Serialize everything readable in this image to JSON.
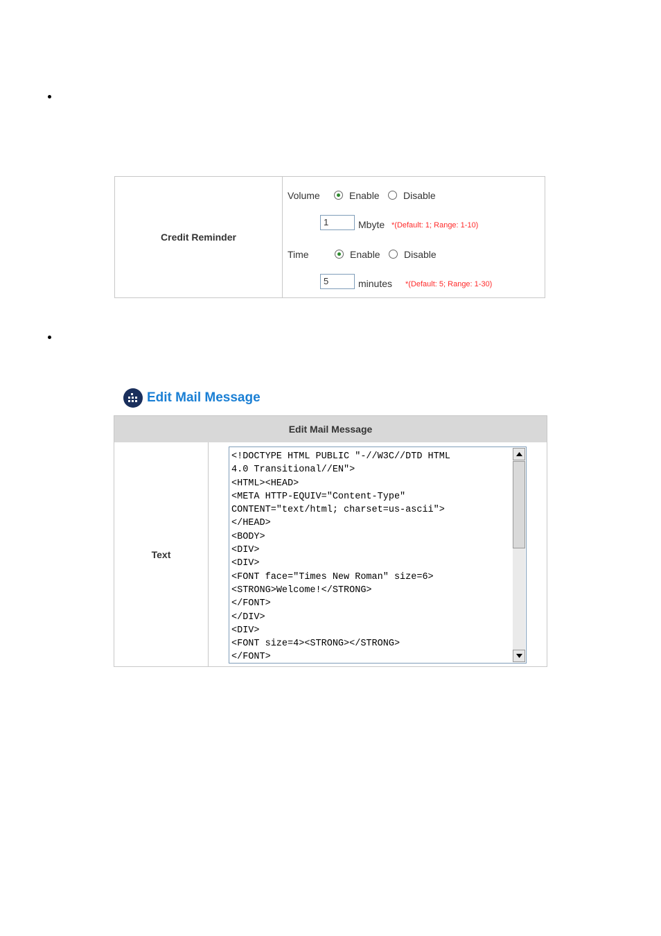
{
  "credit_reminder": {
    "label": "Credit Reminder",
    "volume": {
      "label": "Volume",
      "enable_label": "Enable",
      "disable_label": "Disable",
      "selected": "Enable",
      "value": "1",
      "unit": "Mbyte",
      "hint": "*(Default: 1; Range: 1-10)"
    },
    "time": {
      "label": "Time",
      "enable_label": "Enable",
      "disable_label": "Disable",
      "selected": "Enable",
      "value": "5",
      "unit": "minutes",
      "hint": "*(Default: 5; Range: 1-30)"
    }
  },
  "edit_mail": {
    "title": "Edit Mail Message",
    "header": "Edit Mail Message",
    "field_label": "Text",
    "text_value": "<!DOCTYPE HTML PUBLIC \"-//W3C//DTD HTML\n4.0 Transitional//EN\">\n<HTML><HEAD>\n<META HTTP-EQUIV=\"Content-Type\"\nCONTENT=\"text/html; charset=us-ascii\">\n</HEAD>\n<BODY>\n<DIV>\n<DIV>\n<FONT face=\"Times New Roman\" size=6>\n<STRONG>Welcome!</STRONG>\n</FONT>\n</DIV>\n<DIV>\n<FONT size=4><STRONG></STRONG>\n</FONT>"
  },
  "colors": {
    "accent": "#1a7fd4",
    "hint": "#ff2a2a",
    "header_bg": "#d8d8d8"
  }
}
